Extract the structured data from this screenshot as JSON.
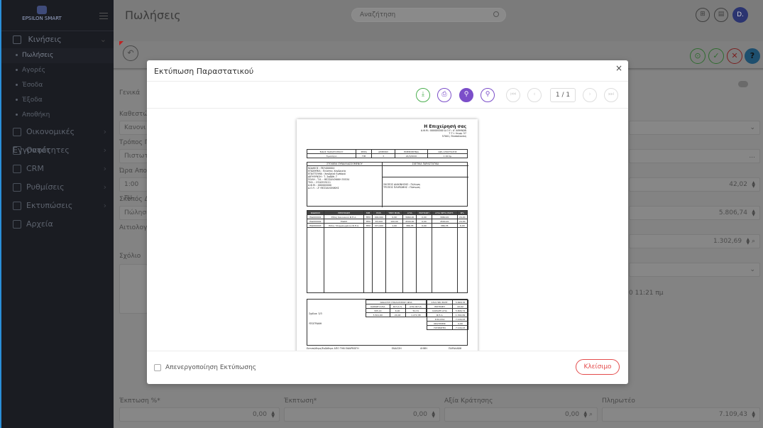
{
  "app": {
    "brand": "EPSILON SMART",
    "brand_sub": "",
    "page_title": "Πωλήσεις",
    "search_placeholder": "Αναζήτηση",
    "avatar": "D."
  },
  "sidebar": {
    "top": {
      "label": "Κινήσεις"
    },
    "sub_items": [
      {
        "label": "Πωλήσεις"
      },
      {
        "label": "Αγορές"
      },
      {
        "label": "Έσοδα"
      },
      {
        "label": "Έξοδα"
      },
      {
        "label": "Αποθήκη"
      }
    ],
    "main_items": [
      {
        "label": "Οικονομικές Εγγραφές"
      },
      {
        "label": "Οντότητες"
      },
      {
        "label": "CRM"
      },
      {
        "label": "Ρυθμίσεις"
      },
      {
        "label": "Εκτυπώσεις"
      },
      {
        "label": "Αρχεία"
      }
    ]
  },
  "form": {
    "labels": [
      "Γενικά",
      "Καθεστώ",
      "Τρόπος Π",
      "Ώρα Απο",
      "Σκοπός Δ",
      "Αιτιολογ",
      "Σχόλιο"
    ],
    "values": [
      "Κανονι",
      "Πιστωτ",
      "1:00 πμ",
      "Πώληση"
    ],
    "right": {
      "v1": "42,02",
      "v2": "5.806,74",
      "v3": "1.302,69",
      "time": "0 11:21 πμ",
      "dots": "..."
    },
    "bottom": {
      "discount_pct_label": "Έκπτωση %*",
      "discount_pct": "0,00",
      "discount_label": "Έκπτωση*",
      "discount": "0,00",
      "withholding_label": "Αξία Κράτησης",
      "withholding": "0,00",
      "payable_label": "Πληρωτέο",
      "payable": "7.109,43"
    }
  },
  "modal": {
    "title": "Εκτύπωση Παραστατικού",
    "close": "×",
    "page": "1",
    "page_total": "/ 1",
    "disable_print": "Απενεργοποίηση Εκτύπωσης",
    "close_button": "Κλείσιμο"
  },
  "doc": {
    "company": "Η Επιχείρησή σας",
    "company_lines": [
      "Α.Φ.Μ.: 000000000 Δ.Ο.Υ.: Α' ΑΘΗΝΩΝ",
      "Τ.Τ.Ι. Λεωφ. 57",
      "57001, Θεσσαλονίκη"
    ],
    "head_cols": [
      "ΕΙΔΟΣ ΠΑΡΑΣΤΑΤΙΚΟΥ",
      "ΣΕΙΡΑ",
      "ΑΡΙΘΜΟΣ",
      "ΗΜΕΡΟΜΗΝΙΑ",
      "ΩΡΑ ΑΠΟΣΤΟΛΗΣ"
    ],
    "head_vals": [
      "Τιμολόγιο",
      "ΤΙΜ",
      "3",
      "24/3/2020",
      "1:00 πμ"
    ],
    "sec_left": "ΣΤΟΙΧΕΙΑ ΣΥΝΑΛΛΑΣΣΟΜΕΝΟΥ",
    "sec_right": "ΣΧΕΤΙΚΑ ΠΑΡΑΣΤΑΤΙΚΑ",
    "cust_lines": [
      "ΚΩΔΙΚΟΣ    : ΠΕΛ000004",
      "ΕΠΩΝΥΜΙΑ   : Πελάτης Χονδρικής",
      "ΕΠΑΓΓΕΛΜΑ  : Χονδρικό Εμπόριο",
      "ΔΙΕΥΘΥΝΣΗ  : Τ. Σαββέι 7",
      "ΠΟΛΗ - Τ.Κ. : ΘΕΣΣΑΛΟΝΙΚΗ 55534",
      "ΤΗΛ.       : 2310555111",
      "Α.Φ.Μ.     : 000000000",
      "Δ.Ο.Υ.     : Ζ' ΘΕΣΣΑΛΟΝΙΚΗΣ"
    ],
    "purpose_lines": [
      "ΣΚΟΠΟΣ ΔΙΑΚΙΝΗΣΗΣ  : Πώληση",
      "ΤΡΟΠΟΣ ΠΛΗΡΩΜΗΣ   : Πίστωση"
    ],
    "line_cols": [
      "ΚΩΔΙΚΟΣ",
      "ΠΕΡΙΓΡΑΦΗ",
      "ΜΜ",
      "ΠΟΣ.",
      "ΤΙΜΗ ΜΟΝ.",
      "ΑΞΙΑ",
      "ΕΚΠΤΩΣΗ",
      "ΑΞΙΑ ΜΕΤΑ ΕΚΠΤ.",
      "Φ%"
    ],
    "lines": [
      [
        "ΕΙΔ000001",
        "Είδος Κανονικού Φ.Π.Α.",
        "ΤΕΜ",
        "400,000",
        "9,90",
        "3960,00",
        "0,00",
        "3960,00",
        "24,00"
      ],
      [
        "ΕΙΔ000002",
        "ΕΙΔΟΣ",
        "ΤΕΜ",
        "45,000",
        "100,00",
        "4500,00",
        "0,00",
        "4500,00",
        "24,00"
      ],
      [
        "ΕΙΔ000003",
        "Είδος Υπερμειωμένου Φ.Π.Α.",
        "ΤΕΜ",
        "377,000",
        "1,00",
        "386,78",
        "0,00",
        "386,78",
        "6,00"
      ]
    ],
    "vat_title": "ΑΝΑΛΥΣΗ ΥΠΟΛΟΓΙΣΜΟΥ ΦΠΑ",
    "vat_cols": [
      "ΚΑΘΑΡΗ ΑΞΙΑ",
      "Φ.Π.Α.%",
      "ΑΞΙΑ Φ.Π.Α."
    ],
    "vat_rows": [
      [
        "305,14",
        "6,00",
        "50,31"
      ],
      [
        "5.501,60",
        "24,00",
        "1.272,38"
      ]
    ],
    "totals": [
      [
        "ΑΞΙΑ ΠΡΟ ΕΚΠΤ.",
        "5.848,76"
      ],
      [
        "ΕΚΠΤΩΣΗ",
        "42,02"
      ],
      [
        "ΚΑΘΑΡΗ ΑΞΙΑ",
        "5.806,74"
      ],
      [
        "Φ.Π.Α.",
        "1.302,69"
      ],
      [
        "ΣΥΝ.ΑΞΙΑ",
        "7.109,43"
      ],
      [
        "ΚΡΑΤΗΣΕΙΣ",
        "0,00"
      ],
      [
        "ΠΛΗΡΩΤΕΟ",
        "7.109,43"
      ]
    ],
    "notes": "Σχόλια: 3/3",
    "sign": "ΥΠΟΓΡΑΦΗ",
    "footer": [
      "Εκτυπώθηκε/Εκδόθηκε ΑΠΟ ΤΗΝ ΕΦΑΡΜΟΓΗ",
      "ΕΚΔΟΣΗ",
      "ΛΗΨΗ",
      "ΠΑΡΑΛΑΒΗ"
    ]
  }
}
